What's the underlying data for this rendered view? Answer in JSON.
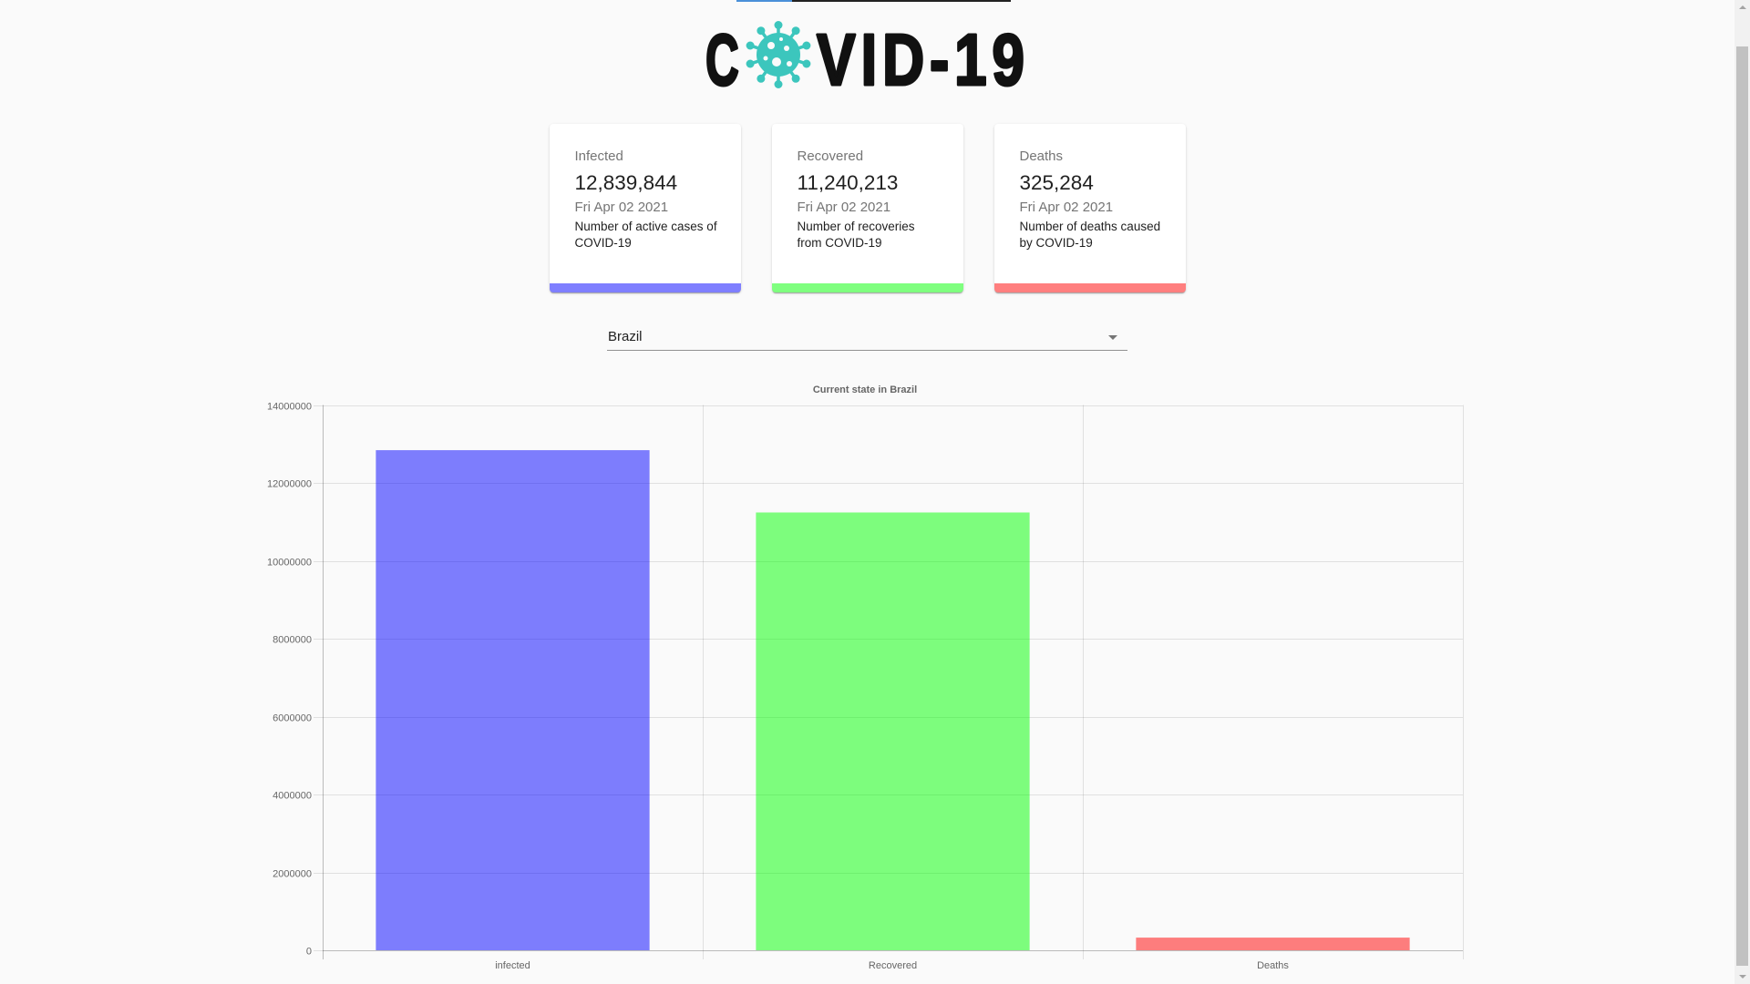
{
  "header": {
    "logo_text": "COVID-19"
  },
  "cards": [
    {
      "title": "Infected",
      "value": "12,839,844",
      "date": "Fri Apr 02 2021",
      "description": "Number of active cases of COVID-19",
      "color": "#0000ff80"
    },
    {
      "title": "Recovered",
      "value": "11,240,213",
      "date": "Fri Apr 02 2021",
      "description": "Number of recoveries from COVID-19",
      "color": "#00ff0080"
    },
    {
      "title": "Deaths",
      "value": "325,284",
      "date": "Fri Apr 02 2021",
      "description": "Number of deaths caused by COVID-19",
      "color": "#ff000080"
    }
  ],
  "country_picker": {
    "selected": "Brazil",
    "icon": "arrow-drop-down-icon"
  },
  "colors": {
    "background": "#fafafa",
    "logo_text": "#111111",
    "virus": "#3cc6bd",
    "top_line": "#222222",
    "top_line_accent": "#4a90d9"
  },
  "icons": {
    "logo": "virus-icon",
    "scroll_up": "scroll-up-arrow-icon",
    "scroll_down": "scroll-down-arrow-icon"
  },
  "chart_data": {
    "type": "bar",
    "title": "Current state in Brazil",
    "categories": [
      "infected",
      "Recovered",
      "Deaths"
    ],
    "values": [
      12839844,
      11240213,
      325284
    ],
    "colors": [
      "#0000ff80",
      "#00ff0080",
      "#ff000080"
    ],
    "ylim": [
      0,
      14000000
    ],
    "yticks": [
      0,
      2000000,
      4000000,
      6000000,
      8000000,
      10000000,
      12000000,
      14000000
    ],
    "grid": true,
    "legend": "none"
  }
}
